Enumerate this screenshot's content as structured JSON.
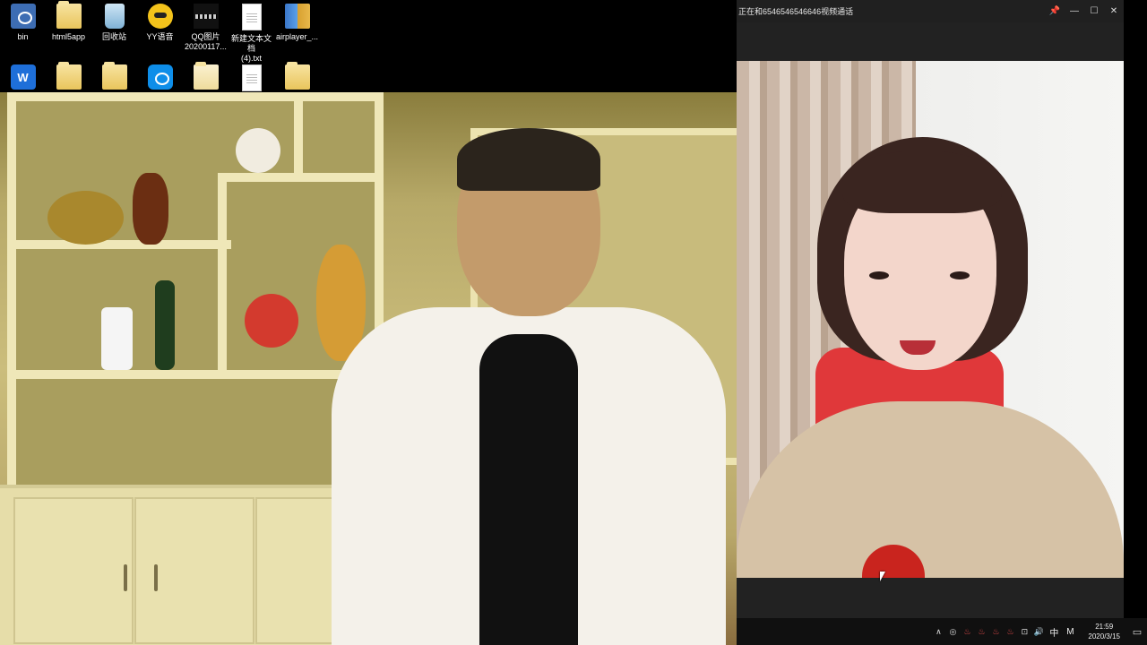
{
  "desktop": {
    "row1": [
      {
        "label": "bin",
        "icon": "program-icon"
      },
      {
        "label": "html5app",
        "icon": "folder-icon"
      },
      {
        "label": "回收站",
        "icon": "recycle-bin-icon"
      },
      {
        "label": "YY语音",
        "icon": "yy-voice-icon"
      },
      {
        "label": "QQ图片\n20200117...",
        "icon": "image-file-icon"
      },
      {
        "label": "新建文本文档\n(4).txt",
        "icon": "text-file-icon"
      },
      {
        "label": "airplayer_...",
        "icon": "archive-icon"
      }
    ],
    "row2": [
      {
        "label": "",
        "icon": "wps-icon"
      },
      {
        "label": "",
        "icon": "folder-icon"
      },
      {
        "label": "",
        "icon": "user-folder-icon"
      },
      {
        "label": "",
        "icon": "teamviewer-icon"
      },
      {
        "label": "",
        "icon": "folder-icon"
      },
      {
        "label": "",
        "icon": "text-file-icon"
      },
      {
        "label": "",
        "icon": "media-folder-icon"
      }
    ]
  },
  "call_window": {
    "title": "正在和6546546546646视频通话",
    "pin_glyph": "📌",
    "min_glyph": "—",
    "max_glyph": "☐",
    "close_glyph": "✕"
  },
  "taskbar": {
    "time": "21:59",
    "date": "2020/3/15",
    "ime_lang": "中",
    "ime_mode": "M",
    "tray_glyphs": [
      "∧",
      "◎",
      "♨",
      "♨",
      "♨",
      "♨",
      "⊡",
      "🔊"
    ],
    "notif_glyph": "▭"
  }
}
